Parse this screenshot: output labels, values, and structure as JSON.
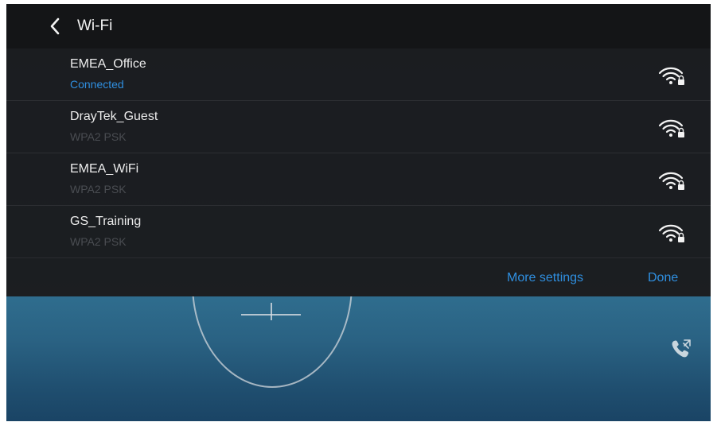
{
  "header": {
    "title": "Wi-Fi"
  },
  "networks": [
    {
      "ssid": "EMEA_Office",
      "status": "Connected",
      "connected": true
    },
    {
      "ssid": "DrayTek_Guest",
      "status": "WPA2 PSK",
      "connected": false
    },
    {
      "ssid": "EMEA_WiFi",
      "status": "WPA2 PSK",
      "connected": false
    },
    {
      "ssid": "GS_Training",
      "status": "WPA2 PSK",
      "connected": false
    }
  ],
  "actions": {
    "more_settings": "More settings",
    "done": "Done"
  },
  "colors": {
    "accent": "#2f8fe0",
    "panel": "#1c1e21",
    "header": "#141517",
    "wallpaper": "#2a6283"
  },
  "icons": {
    "back": "chevron-left-icon",
    "wifi_secured": "wifi-lock-icon",
    "call": "call-transfer-icon",
    "dial": "add-icon"
  }
}
